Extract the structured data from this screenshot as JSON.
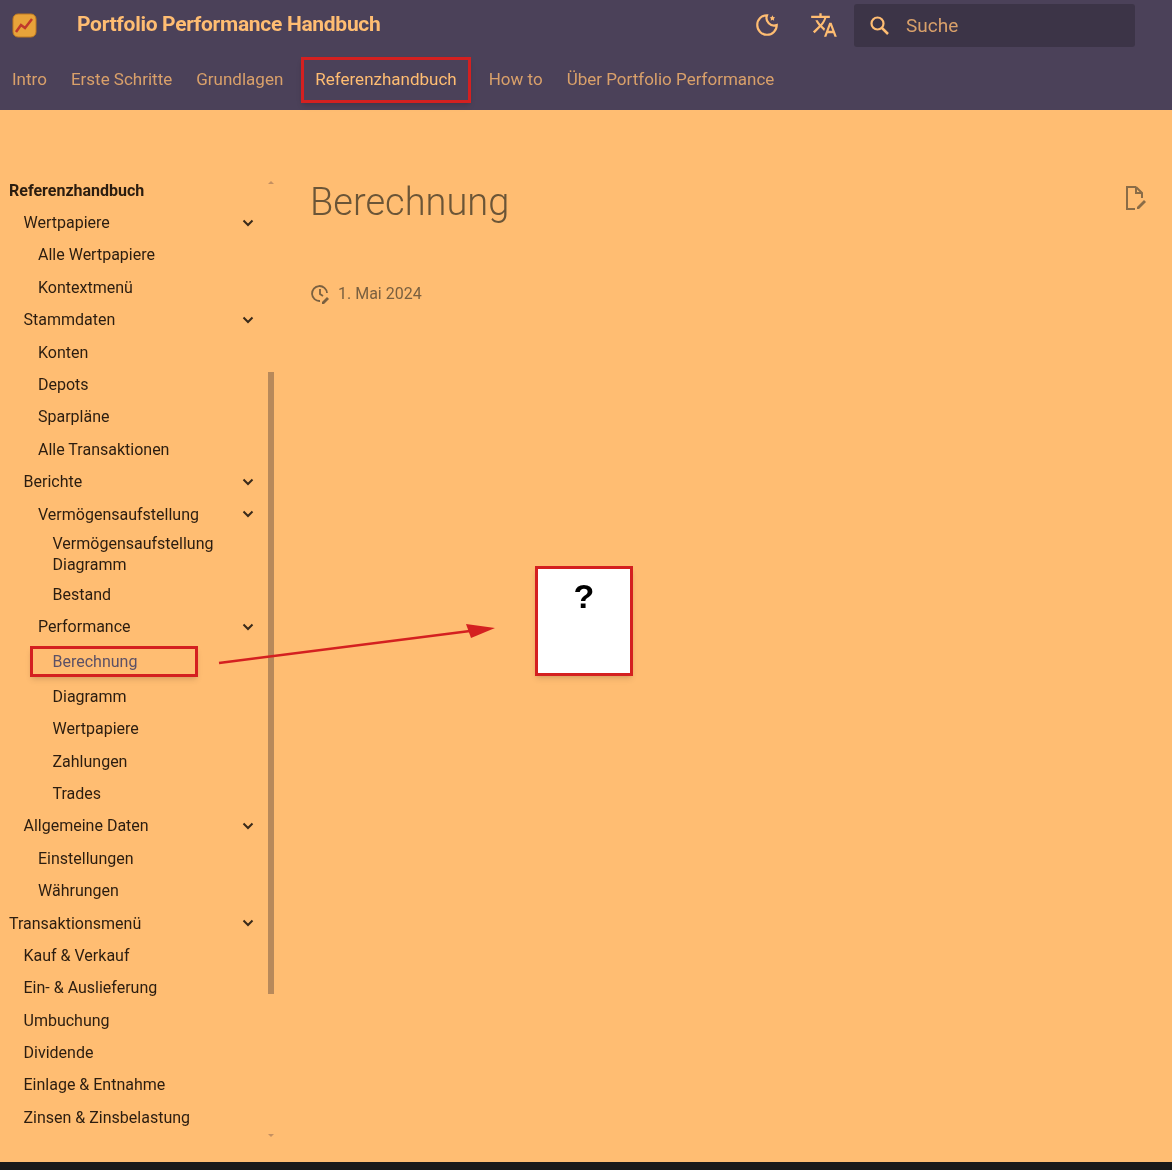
{
  "header": {
    "title": "Portfolio Performance Handbuch",
    "search": {
      "placeholder": "Suche"
    }
  },
  "tabs": [
    {
      "label": "Intro",
      "selected": false,
      "highlighted": false
    },
    {
      "label": "Erste Schritte",
      "selected": false,
      "highlighted": false
    },
    {
      "label": "Grundlagen",
      "selected": false,
      "highlighted": false
    },
    {
      "label": "Referenzhandbuch",
      "selected": true,
      "highlighted": true
    },
    {
      "label": "How to",
      "selected": false,
      "highlighted": false
    },
    {
      "label": "Über Portfolio Performance",
      "selected": false,
      "highlighted": false
    }
  ],
  "sidebar": {
    "items": [
      {
        "label": "Referenzhandbuch",
        "kind": "section",
        "children": [
          {
            "label": "Wertpapiere",
            "kind": "group",
            "expanded": true,
            "children": [
              {
                "label": "Alle Wertpapiere",
                "kind": "page",
                "selected": false,
                "highlighted": false
              },
              {
                "label": "Kontextmenü",
                "kind": "page",
                "selected": false,
                "highlighted": false
              }
            ]
          },
          {
            "label": "Stammdaten",
            "kind": "group",
            "expanded": true,
            "children": [
              {
                "label": "Konten",
                "kind": "page",
                "selected": false,
                "highlighted": false
              },
              {
                "label": "Depots",
                "kind": "page",
                "selected": false,
                "highlighted": false
              },
              {
                "label": "Sparpläne",
                "kind": "page",
                "selected": false,
                "highlighted": false
              },
              {
                "label": "Alle Transaktionen",
                "kind": "page",
                "selected": false,
                "highlighted": false
              }
            ]
          },
          {
            "label": "Berichte",
            "kind": "group",
            "expanded": true,
            "children": [
              {
                "label": "Vermögensaufstellung",
                "kind": "group",
                "expanded": true,
                "children": [
                  {
                    "label": "Vermögensaufstellung Diagramm",
                    "kind": "page",
                    "selected": false,
                    "highlighted": false
                  },
                  {
                    "label": "Bestand",
                    "kind": "page",
                    "selected": false,
                    "highlighted": false
                  }
                ]
              },
              {
                "label": "Performance",
                "kind": "group",
                "expanded": true,
                "children": [
                  {
                    "label": "Berechnung",
                    "kind": "page",
                    "selected": true,
                    "highlighted": true
                  },
                  {
                    "label": "Diagramm",
                    "kind": "page",
                    "selected": false,
                    "highlighted": false
                  },
                  {
                    "label": "Wertpapiere",
                    "kind": "page",
                    "selected": false,
                    "highlighted": false
                  },
                  {
                    "label": "Zahlungen",
                    "kind": "page",
                    "selected": false,
                    "highlighted": false
                  },
                  {
                    "label": "Trades",
                    "kind": "page",
                    "selected": false,
                    "highlighted": false
                  }
                ]
              }
            ]
          },
          {
            "label": "Allgemeine Daten",
            "kind": "group",
            "expanded": true,
            "children": [
              {
                "label": "Einstellungen",
                "kind": "page",
                "selected": false,
                "highlighted": false
              },
              {
                "label": "Währungen",
                "kind": "page",
                "selected": false,
                "highlighted": false
              }
            ]
          }
        ]
      },
      {
        "label": "Transaktionsmenü",
        "kind": "group",
        "expanded": true,
        "children": [
          {
            "label": "Kauf & Verkauf",
            "kind": "page",
            "selected": false,
            "highlighted": false
          },
          {
            "label": "Ein- & Auslieferung",
            "kind": "page",
            "selected": false,
            "highlighted": false
          },
          {
            "label": "Umbuchung",
            "kind": "page",
            "selected": false,
            "highlighted": false
          },
          {
            "label": "Dividende",
            "kind": "page",
            "selected": false,
            "highlighted": false
          },
          {
            "label": "Einlage & Entnahme",
            "kind": "page",
            "selected": false,
            "highlighted": false
          },
          {
            "label": "Zinsen & Zinsbelastung",
            "kind": "page",
            "selected": false,
            "highlighted": false
          }
        ]
      }
    ]
  },
  "content": {
    "title": "Berechnung",
    "date": "1. Mai 2024"
  },
  "annotation": {
    "text": "?"
  }
}
